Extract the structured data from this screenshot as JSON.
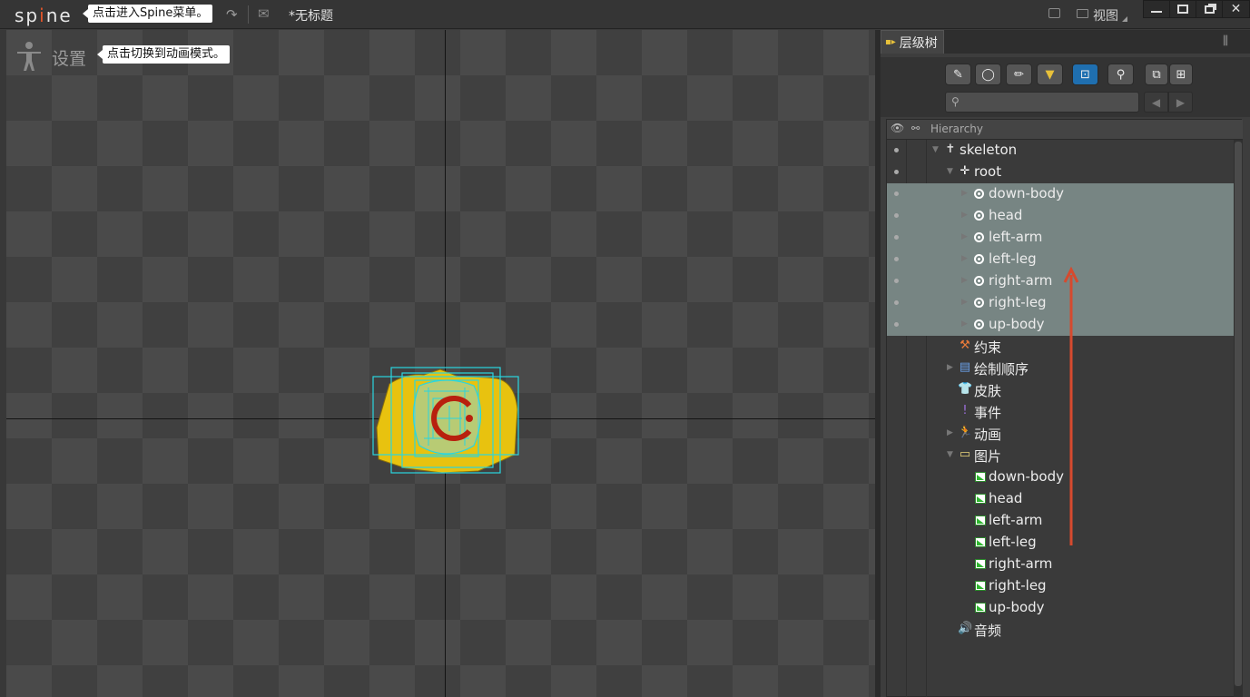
{
  "titlebar": {
    "logo_prefix": "sp",
    "logo_mid": "i",
    "logo_suffix": "ne",
    "menu_tip": "点击进入Spine菜单。",
    "redo_icon": "↷",
    "mail_icon": "✉",
    "file_title": "*无标题",
    "view_label": "视图",
    "window_buttons": [
      "minimize",
      "maximize",
      "restore",
      "close"
    ]
  },
  "viewport": {
    "settings_label": "设置",
    "mode_tip": "点击切换到动画模式。",
    "settings_icon": "stick-figure-icon"
  },
  "panel": {
    "title": "层级树",
    "tree_icon": "hierarchy-icon",
    "settings_icon": "sliders-icon",
    "toolbar_buttons": [
      {
        "name": "brush-tool-button",
        "glyph": "✎",
        "active": false
      },
      {
        "name": "circle-tool-button",
        "glyph": "◯",
        "active": false
      },
      {
        "name": "pencil-tool-button",
        "glyph": "✏",
        "active": false
      },
      {
        "name": "filter-tool-button",
        "glyph": "▼",
        "active": false
      },
      {
        "name": "select-tool-button",
        "glyph": "⊡",
        "active": true
      },
      {
        "name": "pin-tool-button",
        "glyph": "⚲",
        "active": false
      },
      {
        "name": "collapse-button",
        "glyph": "⧉",
        "active": false
      },
      {
        "name": "expand-button",
        "glyph": "⊞",
        "active": false
      }
    ],
    "search_icon": "⚲",
    "nav_back": "◀",
    "nav_forward": "▶",
    "hierarchy_label": "Hierarchy"
  },
  "tree": [
    {
      "label": "skeleton",
      "indent": 0,
      "arrow": "down",
      "icon": "skeleton",
      "dot": true,
      "selected": false
    },
    {
      "label": "root",
      "indent": 1,
      "arrow": "down",
      "icon": "root-bone",
      "dot": true,
      "selected": false
    },
    {
      "label": "down-body",
      "indent": 2,
      "arrow": "right",
      "icon": "bone",
      "dot": true,
      "selected": true
    },
    {
      "label": "head",
      "indent": 2,
      "arrow": "right",
      "icon": "bone",
      "dot": true,
      "selected": true
    },
    {
      "label": "left-arm",
      "indent": 2,
      "arrow": "right",
      "icon": "bone",
      "dot": true,
      "selected": true
    },
    {
      "label": "left-leg",
      "indent": 2,
      "arrow": "right",
      "icon": "bone",
      "dot": true,
      "selected": true
    },
    {
      "label": "right-arm",
      "indent": 2,
      "arrow": "right",
      "icon": "bone",
      "dot": true,
      "selected": true
    },
    {
      "label": "right-leg",
      "indent": 2,
      "arrow": "right",
      "icon": "bone",
      "dot": true,
      "selected": true
    },
    {
      "label": "up-body",
      "indent": 2,
      "arrow": "right",
      "icon": "bone",
      "dot": true,
      "selected": true
    },
    {
      "label": "约束",
      "indent": 1,
      "arrow": "none",
      "icon": "constraint",
      "dot": false,
      "selected": false
    },
    {
      "label": "绘制顺序",
      "indent": 1,
      "arrow": "right",
      "icon": "draw-order",
      "dot": false,
      "selected": false
    },
    {
      "label": "皮肤",
      "indent": 1,
      "arrow": "none",
      "icon": "skin",
      "dot": false,
      "selected": false
    },
    {
      "label": "事件",
      "indent": 1,
      "arrow": "none",
      "icon": "event",
      "dot": false,
      "selected": false
    },
    {
      "label": "动画",
      "indent": 1,
      "arrow": "right",
      "icon": "animation",
      "dot": false,
      "selected": false
    },
    {
      "label": "图片",
      "indent": 1,
      "arrow": "down",
      "icon": "folder",
      "dot": false,
      "selected": false
    },
    {
      "label": "down-body",
      "indent": 2,
      "arrow": "none",
      "icon": "image",
      "dot": false,
      "selected": false
    },
    {
      "label": "head",
      "indent": 2,
      "arrow": "none",
      "icon": "image",
      "dot": false,
      "selected": false
    },
    {
      "label": "left-arm",
      "indent": 2,
      "arrow": "none",
      "icon": "image",
      "dot": false,
      "selected": false
    },
    {
      "label": "left-leg",
      "indent": 2,
      "arrow": "none",
      "icon": "image",
      "dot": false,
      "selected": false
    },
    {
      "label": "right-arm",
      "indent": 2,
      "arrow": "none",
      "icon": "image",
      "dot": false,
      "selected": false
    },
    {
      "label": "right-leg",
      "indent": 2,
      "arrow": "none",
      "icon": "image",
      "dot": false,
      "selected": false
    },
    {
      "label": "up-body",
      "indent": 2,
      "arrow": "none",
      "icon": "image",
      "dot": false,
      "selected": false
    },
    {
      "label": "音频",
      "indent": 1,
      "arrow": "none",
      "icon": "audio",
      "dot": false,
      "selected": false
    }
  ],
  "colors": {
    "accent_red": "#e0552a",
    "selection": "#778583",
    "bone_outline": "#29d6e0",
    "attachment_fill": "#e8c20f",
    "annotation_arrow": "#d64a2e"
  }
}
